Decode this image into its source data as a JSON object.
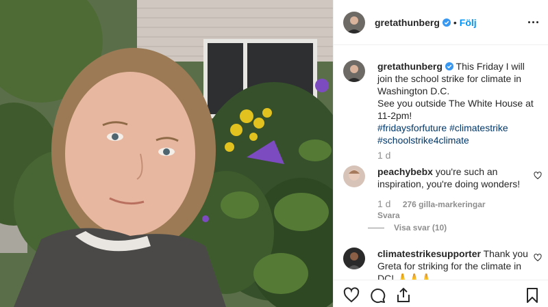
{
  "post": {
    "username": "gretathunberg",
    "follow_label": "Följ",
    "separator": "•",
    "caption_line1": "This Friday I will join the school strike for climate in Washington D.C.",
    "caption_line2": "See you outside The White House at 11-2pm!",
    "hashtags": [
      "#fridaysforfuture",
      "#climatestrike",
      "#schoolstrike4climate"
    ],
    "time": "1 d"
  },
  "comments": [
    {
      "username": "peachybebx",
      "text": "you're such an inspiration, you're doing wonders!",
      "time": "1 d",
      "likes": "276 gilla-markeringar",
      "reply_label": "Svara",
      "view_replies": "Visa svar (10)"
    },
    {
      "username": "climatestrikesupporter",
      "text": "Thank you Greta for striking for the climate in DC! 🙏🙏🙏"
    }
  ],
  "icons": {
    "verified": "verified-badge-icon",
    "more": "more-options-icon",
    "like": "heart-icon",
    "comment": "comment-icon",
    "share": "share-icon",
    "save": "bookmark-icon"
  },
  "colors": {
    "accent": "#0095f6",
    "hashtag": "#00376b",
    "muted": "#8e8e8e"
  }
}
